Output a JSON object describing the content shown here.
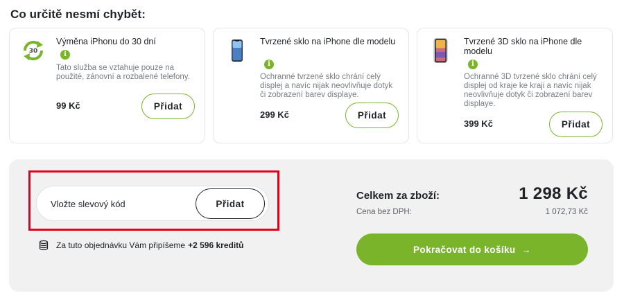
{
  "section": {
    "title": "Co určitě nesmí chybět:"
  },
  "upsell": [
    {
      "name": "Výměna iPhonu do 30 dní",
      "description": "Tato služba se vztahuje pouze na použité, zánovní a rozbalené telefony.",
      "price": "99 Kč",
      "add_label": "Přidat",
      "icon": "exchange-30-icon"
    },
    {
      "name": "Tvrzené sklo na iPhone dle modelu",
      "description": "Ochranné tvrzené sklo chrání celý displej a navíc nijak neovlivňuje dotyk či zobrazení barev displaye.",
      "price": "299 Kč",
      "add_label": "Přidat",
      "icon": "phone-glass-icon"
    },
    {
      "name": "Tvrzené 3D sklo na iPhone dle modelu",
      "description": "Ochranné 3D tvrzené sklo chrání celý displej od kraje ke kraji a navíc nijak neovlivňuje dotyk či zobrazení barev displaye.",
      "price": "399 Kč",
      "add_label": "Přidat",
      "icon": "phone-3d-glass-icon"
    }
  ],
  "info_icon_glyph": "i",
  "coupon": {
    "placeholder": "Vložte slevový kód",
    "button_label": "Přidat"
  },
  "credits": {
    "text": "Za tuto objednávku Vám připíšeme",
    "amount": "+2 596 kreditů"
  },
  "summary": {
    "total_label": "Celkem za zboží:",
    "total_value": "1 298 Kč",
    "net_label": "Cena bez DPH:",
    "net_value": "1 072,73 Kč"
  },
  "checkout": {
    "label": "Pokračovat do košíku",
    "arrow": "→"
  },
  "colors": {
    "accent": "#7ab42b",
    "highlight": "#e4001b",
    "panel": "#f1f1f1"
  }
}
